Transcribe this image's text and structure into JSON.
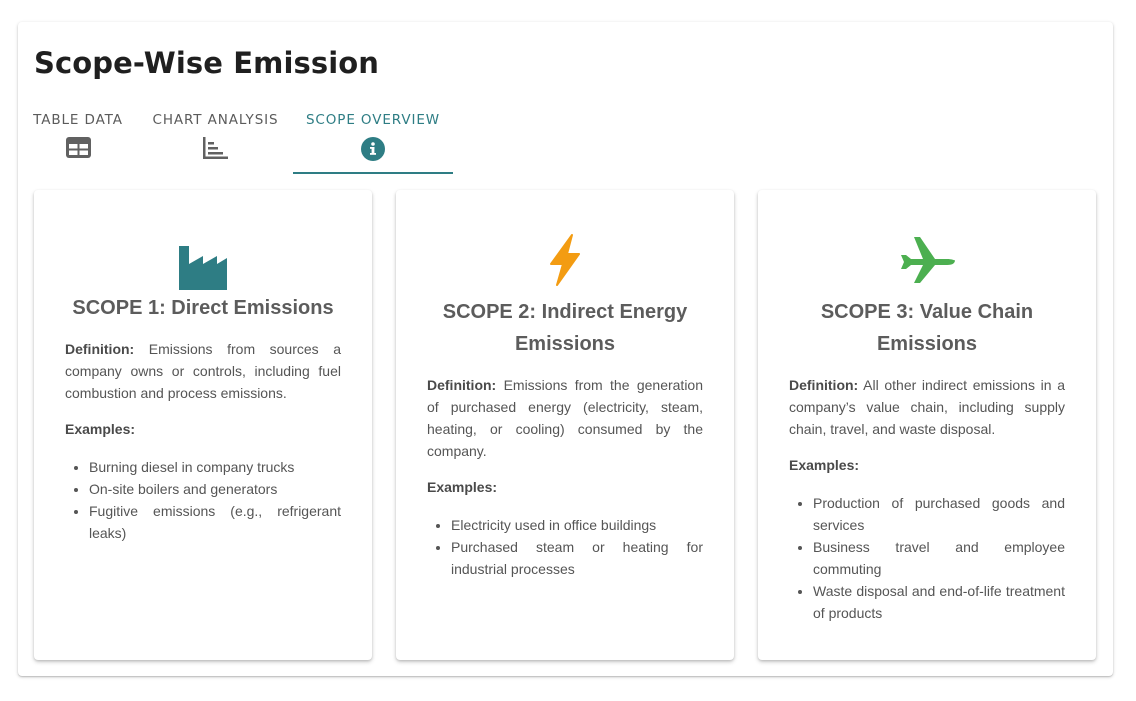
{
  "page": {
    "title": "Scope-Wise Emission"
  },
  "tabs": [
    {
      "label": "TABLE DATA",
      "icon": "table-icon",
      "active": false
    },
    {
      "label": "CHART ANALYSIS",
      "icon": "bar-chart-icon",
      "active": false
    },
    {
      "label": "SCOPE OVERVIEW",
      "icon": "info-icon",
      "active": true
    }
  ],
  "colors": {
    "accent": "#2e7d84",
    "scope1_icon": "#2e7d84",
    "scope2_icon": "#f39c12",
    "scope3_icon": "#4caf50",
    "tab_icon": "#616161"
  },
  "cards": [
    {
      "icon": "factory-icon",
      "title": "SCOPE 1: Direct Emissions",
      "definition_label": "Definition:",
      "definition": "Emissions from sources a company owns or controls, including fuel combustion and process emissions.",
      "examples_label": "Examples:",
      "examples": [
        "Burning diesel in company trucks",
        "On-site boilers and generators",
        "Fugitive emissions (e.g., refrigerant leaks)"
      ]
    },
    {
      "icon": "lightning-bolt-icon",
      "title": "SCOPE 2: Indirect Energy Emissions",
      "definition_label": "Definition:",
      "definition": "Emissions from the generation of purchased energy (electricity, steam, heating, or cooling) consumed by the company.",
      "examples_label": "Examples:",
      "examples": [
        "Electricity used in office buildings",
        "Purchased steam or heating for industrial processes"
      ]
    },
    {
      "icon": "airplane-icon",
      "title": "SCOPE 3: Value Chain Emissions",
      "definition_label": "Definition:",
      "definition": "All other indirect emissions in a company’s value chain, including supply chain, travel, and waste disposal.",
      "examples_label": "Examples:",
      "examples": [
        "Production of purchased goods and services",
        "Business travel and employee commuting",
        "Waste disposal and end-of-life treatment of products"
      ]
    }
  ]
}
